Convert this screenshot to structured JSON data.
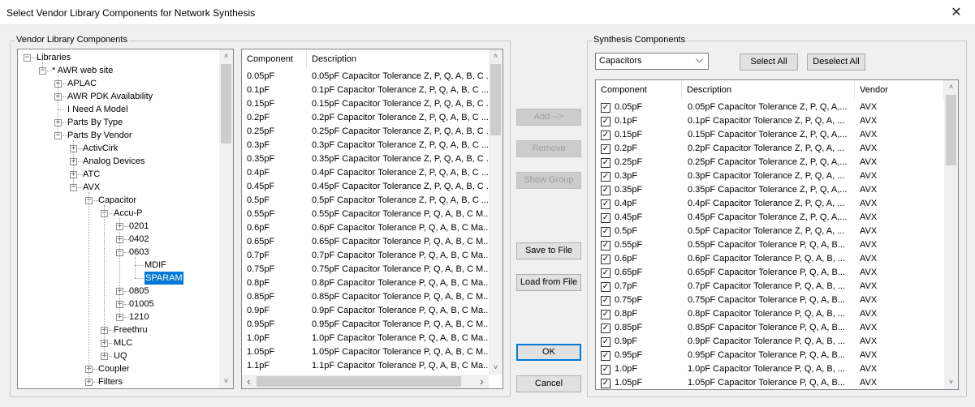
{
  "window": {
    "title": "Select Vendor Library Components for Network Synthesis",
    "close_glyph": "✕"
  },
  "vendor_group": {
    "label": "Vendor Library Components"
  },
  "synthesis_group": {
    "label": "Synthesis Components"
  },
  "tree": [
    {
      "label": "Libraries",
      "level": 0,
      "exp": "−"
    },
    {
      "label": "* AWR web site",
      "level": 1,
      "exp": "−"
    },
    {
      "label": "APLAC",
      "level": 2,
      "exp": "+"
    },
    {
      "label": "AWR PDK Availability",
      "level": 2,
      "exp": "+"
    },
    {
      "label": "I Need A Model",
      "level": 2,
      "exp": ""
    },
    {
      "label": "Parts By Type",
      "level": 2,
      "exp": "+"
    },
    {
      "label": "Parts By Vendor",
      "level": 2,
      "exp": "−"
    },
    {
      "label": "ActivCirk",
      "level": 3,
      "exp": "+"
    },
    {
      "label": "Analog Devices",
      "level": 3,
      "exp": "+"
    },
    {
      "label": "ATC",
      "level": 3,
      "exp": "+"
    },
    {
      "label": "AVX",
      "level": 3,
      "exp": "−"
    },
    {
      "label": "Capacitor",
      "level": 4,
      "exp": "−"
    },
    {
      "label": "Accu-P",
      "level": 5,
      "exp": "−"
    },
    {
      "label": "0201",
      "level": 6,
      "exp": "+"
    },
    {
      "label": "0402",
      "level": 6,
      "exp": "+"
    },
    {
      "label": "0603",
      "level": 6,
      "exp": "−"
    },
    {
      "label": "MDIF",
      "level": 7,
      "exp": ""
    },
    {
      "label": "SPARAM",
      "level": 7,
      "exp": "",
      "selected": true
    },
    {
      "label": "0805",
      "level": 6,
      "exp": "+"
    },
    {
      "label": "01005",
      "level": 6,
      "exp": "+"
    },
    {
      "label": "1210",
      "level": 6,
      "exp": "+"
    },
    {
      "label": "Freethru",
      "level": 5,
      "exp": "+"
    },
    {
      "label": "MLC",
      "level": 5,
      "exp": "+"
    },
    {
      "label": "UQ",
      "level": 5,
      "exp": "+"
    },
    {
      "label": "Coupler",
      "level": 4,
      "exp": "+"
    },
    {
      "label": "Filters",
      "level": 4,
      "exp": "+"
    }
  ],
  "library_list": {
    "headers": [
      "Component",
      "Description"
    ],
    "rows": [
      [
        "0.05pF",
        "0.05pF Capacitor Tolerance Z, P, Q, A, B, C ..."
      ],
      [
        "0.1pF",
        "0.1pF Capacitor Tolerance Z, P, Q, A, B, C ..."
      ],
      [
        "0.15pF",
        "0.15pF Capacitor Tolerance Z, P, Q, A, B, C ..."
      ],
      [
        "0.2pF",
        "0.2pF Capacitor Tolerance Z, P, Q, A, B, C ..."
      ],
      [
        "0.25pF",
        "0.25pF Capacitor Tolerance Z, P, Q, A, B, C ..."
      ],
      [
        "0.3pF",
        "0.3pF Capacitor Tolerance Z, P, Q, A, B, C ..."
      ],
      [
        "0.35pF",
        "0.35pF Capacitor Tolerance Z, P, Q, A, B, C ..."
      ],
      [
        "0.4pF",
        "0.4pF Capacitor Tolerance Z, P, Q, A, B, C ..."
      ],
      [
        "0.45pF",
        "0.45pF Capacitor Tolerance Z, P, Q, A, B, C ..."
      ],
      [
        "0.5pF",
        "0.5pF Capacitor Tolerance Z, P, Q, A, B, C ..."
      ],
      [
        "0.55pF",
        "0.55pF Capacitor Tolerance  P, Q, A, B, C  M..."
      ],
      [
        "0.6pF",
        "0.6pF Capacitor Tolerance  P, Q, A, B, C  Ma..."
      ],
      [
        "0.65pF",
        "0.65pF Capacitor Tolerance  P, Q, A, B, C  M..."
      ],
      [
        "0.7pF",
        "0.7pF Capacitor Tolerance  P, Q, A, B, C  Ma..."
      ],
      [
        "0.75pF",
        "0.75pF Capacitor Tolerance  P, Q, A, B, C  M..."
      ],
      [
        "0.8pF",
        "0.8pF Capacitor Tolerance  P, Q, A, B, C  Ma..."
      ],
      [
        "0.85pF",
        "0.85pF Capacitor Tolerance  P, Q, A, B, C  M..."
      ],
      [
        "0.9pF",
        "0.9pF Capacitor Tolerance  P, Q, A, B, C  Ma..."
      ],
      [
        "0.95pF",
        "0.95pF Capacitor Tolerance  P, Q, A, B, C  M..."
      ],
      [
        "1.0pF",
        "1.0pF Capacitor Tolerance  P, Q, A, B, C  Ma..."
      ],
      [
        "1.05pF",
        "1.05pF Capacitor Tolerance  P, Q, A, B, C  M..."
      ],
      [
        "1.1pF",
        "1.1pF Capacitor Tolerance  P, Q, A, B, C  Ma..."
      ]
    ]
  },
  "buttons": {
    "add": "Add  -->",
    "remove": "Remove",
    "show_group": "Show Group",
    "save_to_file": "Save to File",
    "load_from_file": "Load from File",
    "ok": "OK",
    "cancel": "Cancel",
    "select_all": "Select All",
    "deselect_all": "Deselect All"
  },
  "filter_select": {
    "value": "Capacitors"
  },
  "synthesis_list": {
    "headers": [
      "Component",
      "Description",
      "Vendor"
    ],
    "rows": [
      [
        "0.05pF",
        "0.05pF Capacitor Tolerance Z, P, Q, A,...",
        "AVX"
      ],
      [
        "0.1pF",
        "0.1pF Capacitor Tolerance Z, P, Q, A, ...",
        "AVX"
      ],
      [
        "0.15pF",
        "0.15pF Capacitor Tolerance Z, P, Q, A,...",
        "AVX"
      ],
      [
        "0.2pF",
        "0.2pF Capacitor Tolerance Z, P, Q, A, ...",
        "AVX"
      ],
      [
        "0.25pF",
        "0.25pF Capacitor Tolerance Z, P, Q, A,...",
        "AVX"
      ],
      [
        "0.3pF",
        "0.3pF Capacitor Tolerance Z, P, Q, A, ...",
        "AVX"
      ],
      [
        "0.35pF",
        "0.35pF Capacitor Tolerance Z, P, Q, A,...",
        "AVX"
      ],
      [
        "0.4pF",
        "0.4pF Capacitor Tolerance Z, P, Q, A, ...",
        "AVX"
      ],
      [
        "0.45pF",
        "0.45pF Capacitor Tolerance Z, P, Q, A,...",
        "AVX"
      ],
      [
        "0.5pF",
        "0.5pF Capacitor Tolerance Z, P, Q, A, ...",
        "AVX"
      ],
      [
        "0.55pF",
        "0.55pF Capacitor Tolerance  P, Q, A, B...",
        "AVX"
      ],
      [
        "0.6pF",
        "0.6pF Capacitor Tolerance  P, Q, A, B, ...",
        "AVX"
      ],
      [
        "0.65pF",
        "0.65pF Capacitor Tolerance  P, Q, A, B...",
        "AVX"
      ],
      [
        "0.7pF",
        "0.7pF Capacitor Tolerance  P, Q, A, B, ...",
        "AVX"
      ],
      [
        "0.75pF",
        "0.75pF Capacitor Tolerance  P, Q, A, B...",
        "AVX"
      ],
      [
        "0.8pF",
        "0.8pF Capacitor Tolerance  P, Q, A, B, ...",
        "AVX"
      ],
      [
        "0.85pF",
        "0.85pF Capacitor Tolerance  P, Q, A, B...",
        "AVX"
      ],
      [
        "0.9pF",
        "0.9pF Capacitor Tolerance  P, Q, A, B, ...",
        "AVX"
      ],
      [
        "0.95pF",
        "0.95pF Capacitor Tolerance  P, Q, A, B...",
        "AVX"
      ],
      [
        "1.0pF",
        "1.0pF Capacitor Tolerance  P, Q, A, B, ...",
        "AVX"
      ],
      [
        "1.05pF",
        "1.05pF Capacitor Tolerance  P, Q, A, B...",
        "AVX"
      ]
    ]
  },
  "icons": {
    "up": "˄",
    "down": "˅",
    "left": "‹",
    "right": "›",
    "dropdown": "⌵",
    "check": "✓"
  }
}
